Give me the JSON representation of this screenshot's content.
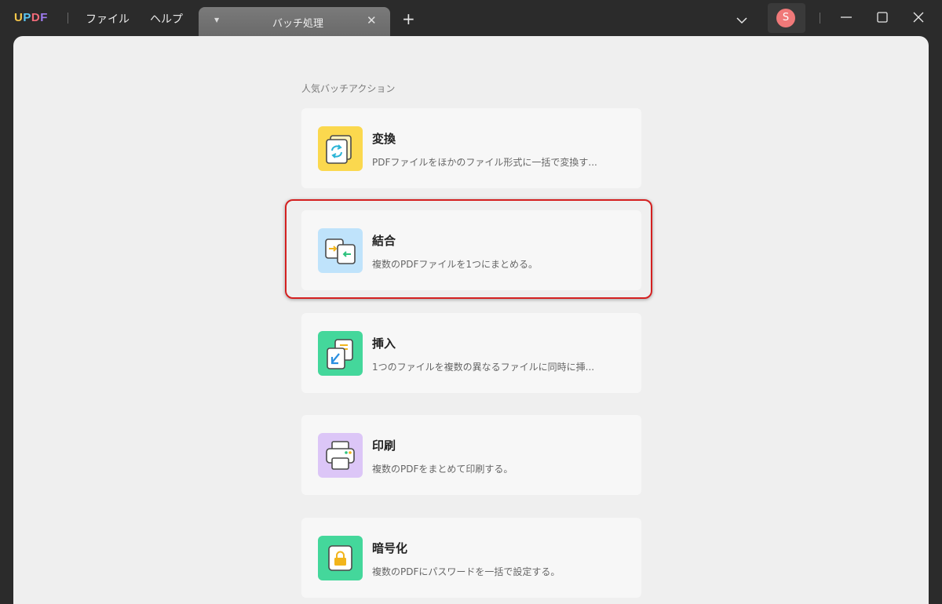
{
  "app": {
    "logo_letters": [
      "U",
      "P",
      "D",
      "F"
    ],
    "logo_colors": [
      "#f7c84a",
      "#59c7f5",
      "#f26b7a",
      "#a07cf2"
    ]
  },
  "menu": {
    "file_label": "ファイル",
    "help_label": "ヘルプ"
  },
  "tab": {
    "label": "バッチ処理",
    "dropdown_icon": "caret-down-icon",
    "close_icon": "close-icon"
  },
  "new_tab_icon": "plus-icon",
  "user": {
    "avatar_initial": "S",
    "avatar_color": "#f07979"
  },
  "window_controls": [
    "chevron-down-icon",
    "minimize-icon",
    "maximize-icon",
    "close-icon"
  ],
  "main": {
    "section_title": "人気バッチアクション",
    "cards": [
      {
        "title": "変換",
        "desc": "PDFファイルをほかのファイル形式に一括で変換す...",
        "icon": "convert-icon",
        "icon_bg": "#fbd84e"
      },
      {
        "title": "結合",
        "desc": "複数のPDFファイルを1つにまとめる。",
        "icon": "combine-icon",
        "icon_bg": "#bfe3fb"
      },
      {
        "title": "挿入",
        "desc": "1つのファイルを複数の異なるファイルに同時に挿...",
        "icon": "insert-icon",
        "icon_bg": "#44d79b"
      },
      {
        "title": "印刷",
        "desc": "複数のPDFをまとめて印刷する。",
        "icon": "print-icon",
        "icon_bg": "#dcc6f7"
      },
      {
        "title": "暗号化",
        "desc": "複数のPDFにパスワードを一括で設定する。",
        "icon": "encrypt-icon",
        "icon_bg": "#44d79b"
      }
    ]
  },
  "highlight_color": "#d42020"
}
